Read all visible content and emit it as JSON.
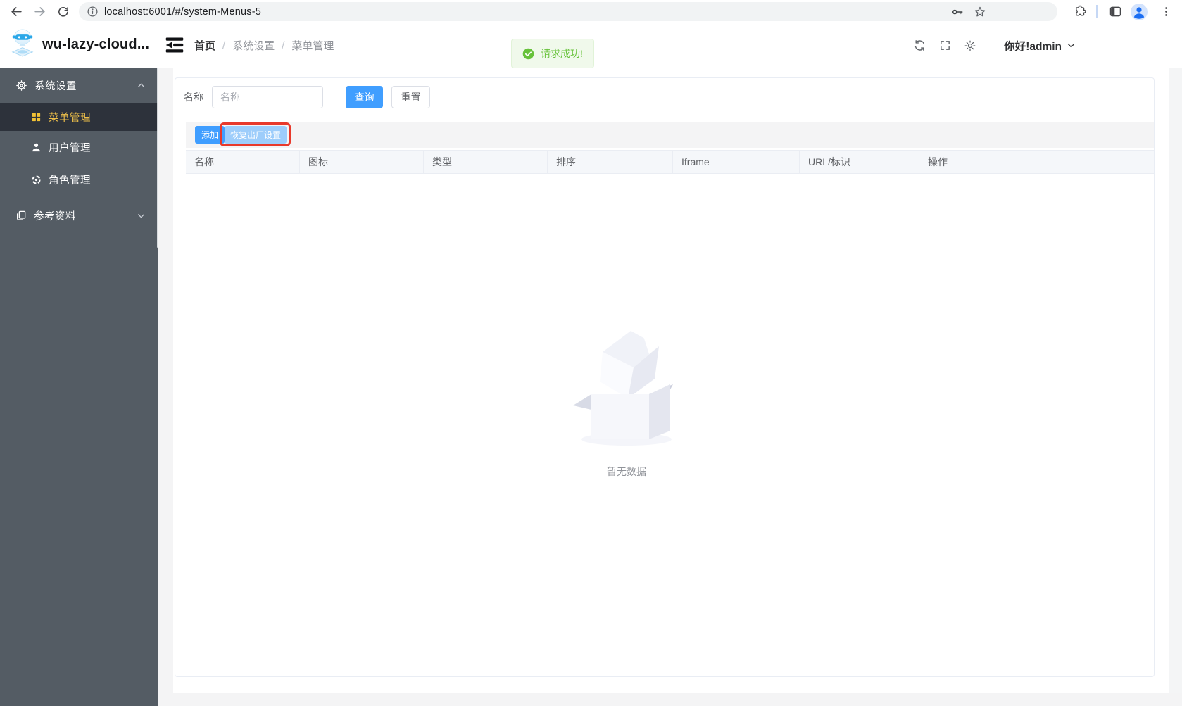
{
  "browser": {
    "url": "localhost:6001/#/system-Menus-5",
    "icons": [
      "back-arrow",
      "forward-arrow",
      "reload",
      "page-info",
      "password-key",
      "bookmark-star",
      "extensions-puzzle",
      "side-panel",
      "profile",
      "menu-dots"
    ]
  },
  "header": {
    "app_title": "wu-lazy-cloud...",
    "breadcrumb": [
      "首页",
      "系统设置",
      "菜单管理"
    ],
    "separator": "/",
    "greeting": "你好!admin",
    "icons": [
      "collapse-menu",
      "refresh",
      "fullscreen",
      "theme-sun",
      "chevron-down"
    ]
  },
  "toast": {
    "type": "success",
    "message": "请求成功!"
  },
  "sidebar": {
    "items": [
      {
        "label": "系统设置",
        "icon": "gear",
        "expanded": true
      },
      {
        "label": "菜单管理",
        "icon": "grid",
        "active": true
      },
      {
        "label": "用户管理",
        "icon": "user"
      },
      {
        "label": "角色管理",
        "icon": "role"
      },
      {
        "label": "参考资料",
        "icon": "documents",
        "expanded": false
      }
    ]
  },
  "filter": {
    "label": "名称",
    "placeholder": "名称",
    "query_button": "查询",
    "reset_button": "重置"
  },
  "toolbar": {
    "add_button": "添加",
    "restore_button": "恢复出厂设置"
  },
  "table": {
    "columns": [
      "名称",
      "图标",
      "类型",
      "排序",
      "Iframe",
      "URL/标识",
      "操作"
    ],
    "rows": [],
    "empty_text": "暂无数据"
  },
  "colors": {
    "accent": "#409eff",
    "success": "#67c23a",
    "sidebar_bg": "#545c64",
    "sidebar_active_bg": "#2d323b",
    "sidebar_active_text": "#ecbe4a",
    "annotation_red": "#e8392b",
    "restore_button_bg": "#9dcdfb"
  }
}
